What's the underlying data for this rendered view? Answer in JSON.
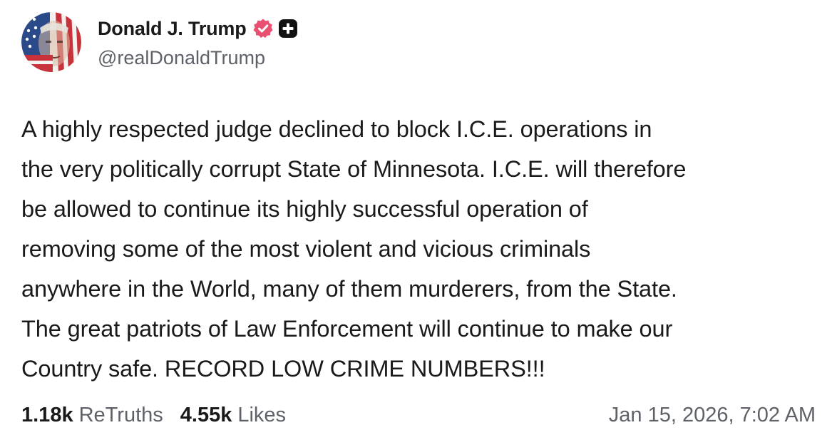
{
  "author": {
    "display_name": "Donald J. Trump",
    "handle": "@realDonaldTrump",
    "avatar_icon": "flag-portrait-avatar",
    "verified_badge_color": "#e94f71",
    "plus_badge_color": "#111111"
  },
  "post": {
    "lines": [
      "A highly respected judge declined to block I.C.E. operations in",
      "the very politically corrupt State of Minnesota. I.C.E. will therefore",
      "be allowed to continue its highly successful operation of",
      "removing some of the most violent and vicious criminals",
      "anywhere in the World, many of them murderers, from the State.",
      "The great patriots of Law Enforcement will continue to make our",
      "Country safe. RECORD LOW CRIME NUMBERS!!!"
    ]
  },
  "stats": {
    "retruths_count": "1.18k",
    "retruths_label": "ReTruths",
    "likes_count": "4.55k",
    "likes_label": "Likes"
  },
  "timestamp": "Jan 15, 2026, 7:02 AM"
}
